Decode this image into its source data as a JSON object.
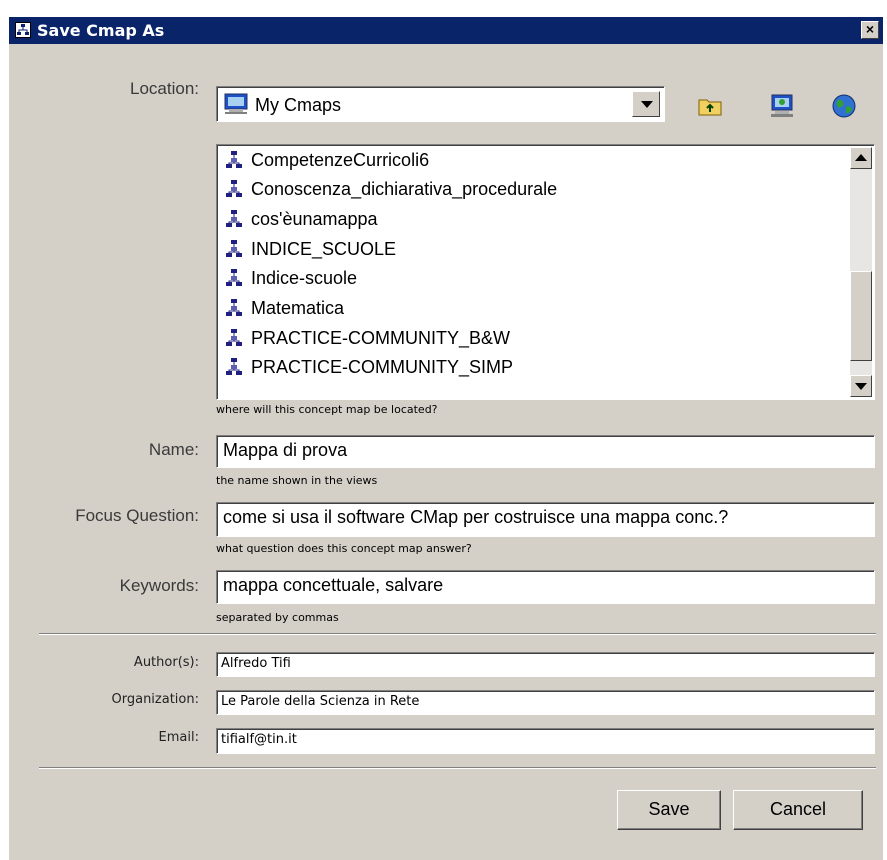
{
  "window": {
    "title": "Save Cmap As"
  },
  "location": {
    "label": "Location:",
    "selected": "My Cmaps",
    "hint": "where will this concept map be located?"
  },
  "toolbar": {
    "icons": [
      "folder-up-icon",
      "my-cmaps-icon",
      "network-globe-icon"
    ]
  },
  "file_list": {
    "items": [
      "CompetenzeCurricoli6",
      "Conoscenza_dichiarativa_procedurale",
      "cos'èunamappa",
      "INDICE_SCUOLE",
      "Indice-scuole",
      "Matematica",
      "PRACTICE-COMMUNITY_B&W",
      "PRACTICE-COMMUNITY_SIMP"
    ]
  },
  "name": {
    "label": "Name:",
    "value": "Mappa di prova",
    "hint": "the name shown in the views"
  },
  "focus_question": {
    "label": "Focus Question:",
    "value": "come si usa il software CMap per costruisce una mappa conc.?",
    "hint": "what question does this concept map answer?"
  },
  "keywords": {
    "label": "Keywords:",
    "value": "mappa concettuale, salvare",
    "hint": "separated by commas"
  },
  "author": {
    "label": "Author(s):",
    "value": "Alfredo Tifi"
  },
  "organization": {
    "label": "Organization:",
    "value": "Le Parole della Scienza in Rete"
  },
  "email": {
    "label": "Email:",
    "value": "tifialf@tin.it"
  },
  "buttons": {
    "save": "Save",
    "cancel": "Cancel"
  },
  "colors": {
    "titlebar": "#0a246a",
    "dialog": "#d4d0c8",
    "field": "#ffffff"
  }
}
